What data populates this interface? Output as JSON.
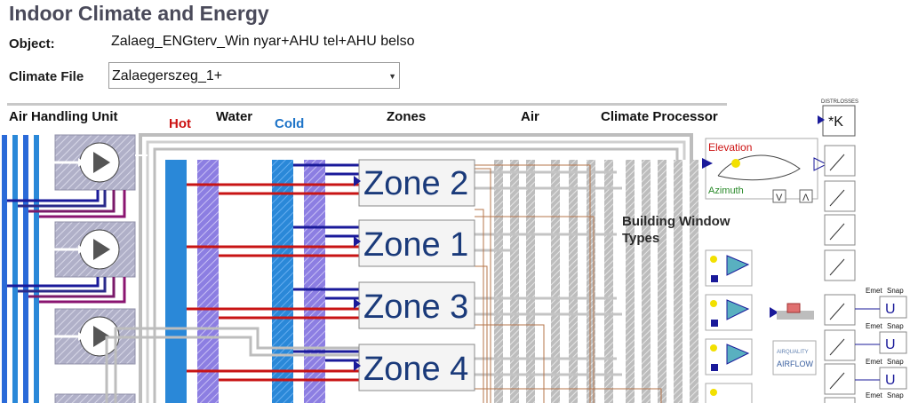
{
  "app": {
    "title": "Indoor Climate and Energy"
  },
  "object": {
    "label": "Object:",
    "value": "Zalaeg_ENGterv_Win nyar+AHU tel+AHU belso"
  },
  "climate_file": {
    "label": "Climate File",
    "value": "Zalaegerszeg_1+"
  },
  "headers": {
    "ahu": "Air Handling Unit",
    "hot": "Hot",
    "water": "Water",
    "cold": "Cold",
    "zones": "Zones",
    "air": "Air",
    "climate_processor": "Climate Processor"
  },
  "zones": [
    "Zone 2",
    "Zone 1",
    "Zone 3",
    "Zone 4"
  ],
  "distrlosses": {
    "label": "DISTRLOSSES",
    "value": "*K"
  },
  "climate": {
    "elevation": "Elevation",
    "azimuth": "Azimuth"
  },
  "building_window": {
    "line1": "Building Window",
    "line2": "Types"
  },
  "airquality": {
    "line1": "AIRQUALITY",
    "line2": "AIRFLOW"
  },
  "emet": [
    "Emet",
    "Snap"
  ],
  "colors": {
    "hot": "#cc1111",
    "cold": "#1e74c8",
    "pipe_blue": "#1a1a9a",
    "pipe_red": "#c81414",
    "water_blue": "#2a88d8",
    "water_purple": "#8a7ae0",
    "title": "#4a4a5a"
  }
}
